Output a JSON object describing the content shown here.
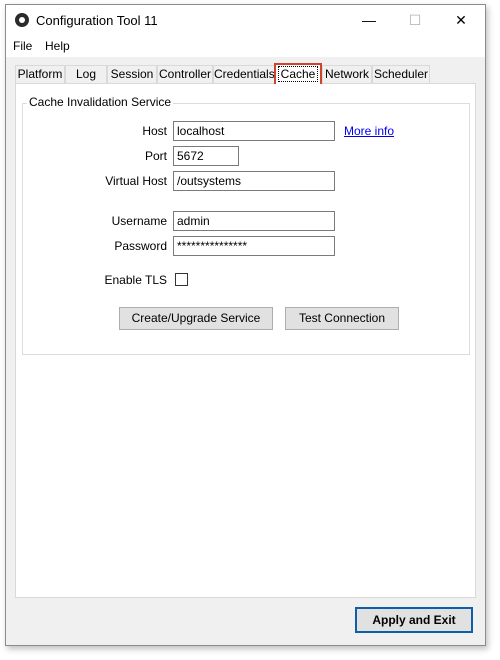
{
  "window": {
    "title": "Configuration Tool 11",
    "minimize": "—",
    "maximize": "☐",
    "close": "✕"
  },
  "menu": {
    "items": [
      "File",
      "Help"
    ]
  },
  "tabs": [
    "Platform",
    "Log",
    "Session",
    "Controller",
    "Credentials",
    "Cache",
    "Network",
    "Scheduler"
  ],
  "active_tab": "Cache",
  "group": {
    "title": "Cache Invalidation Service"
  },
  "form": {
    "host_label": "Host",
    "host_value": "localhost",
    "more_info": "More info",
    "port_label": "Port",
    "port_value": "5672",
    "vhost_label": "Virtual Host",
    "vhost_value": "/outsystems",
    "username_label": "Username",
    "username_value": "admin",
    "password_label": "Password",
    "password_value": "***************",
    "tls_label": "Enable TLS",
    "tls_checked": false
  },
  "buttons": {
    "create": "Create/Upgrade Service",
    "test": "Test Connection",
    "apply": "Apply and Exit"
  },
  "colors": {
    "active_tab_outline": "#d0442e",
    "primary_button_border": "#0f5fa8",
    "link": "#0000ee"
  }
}
